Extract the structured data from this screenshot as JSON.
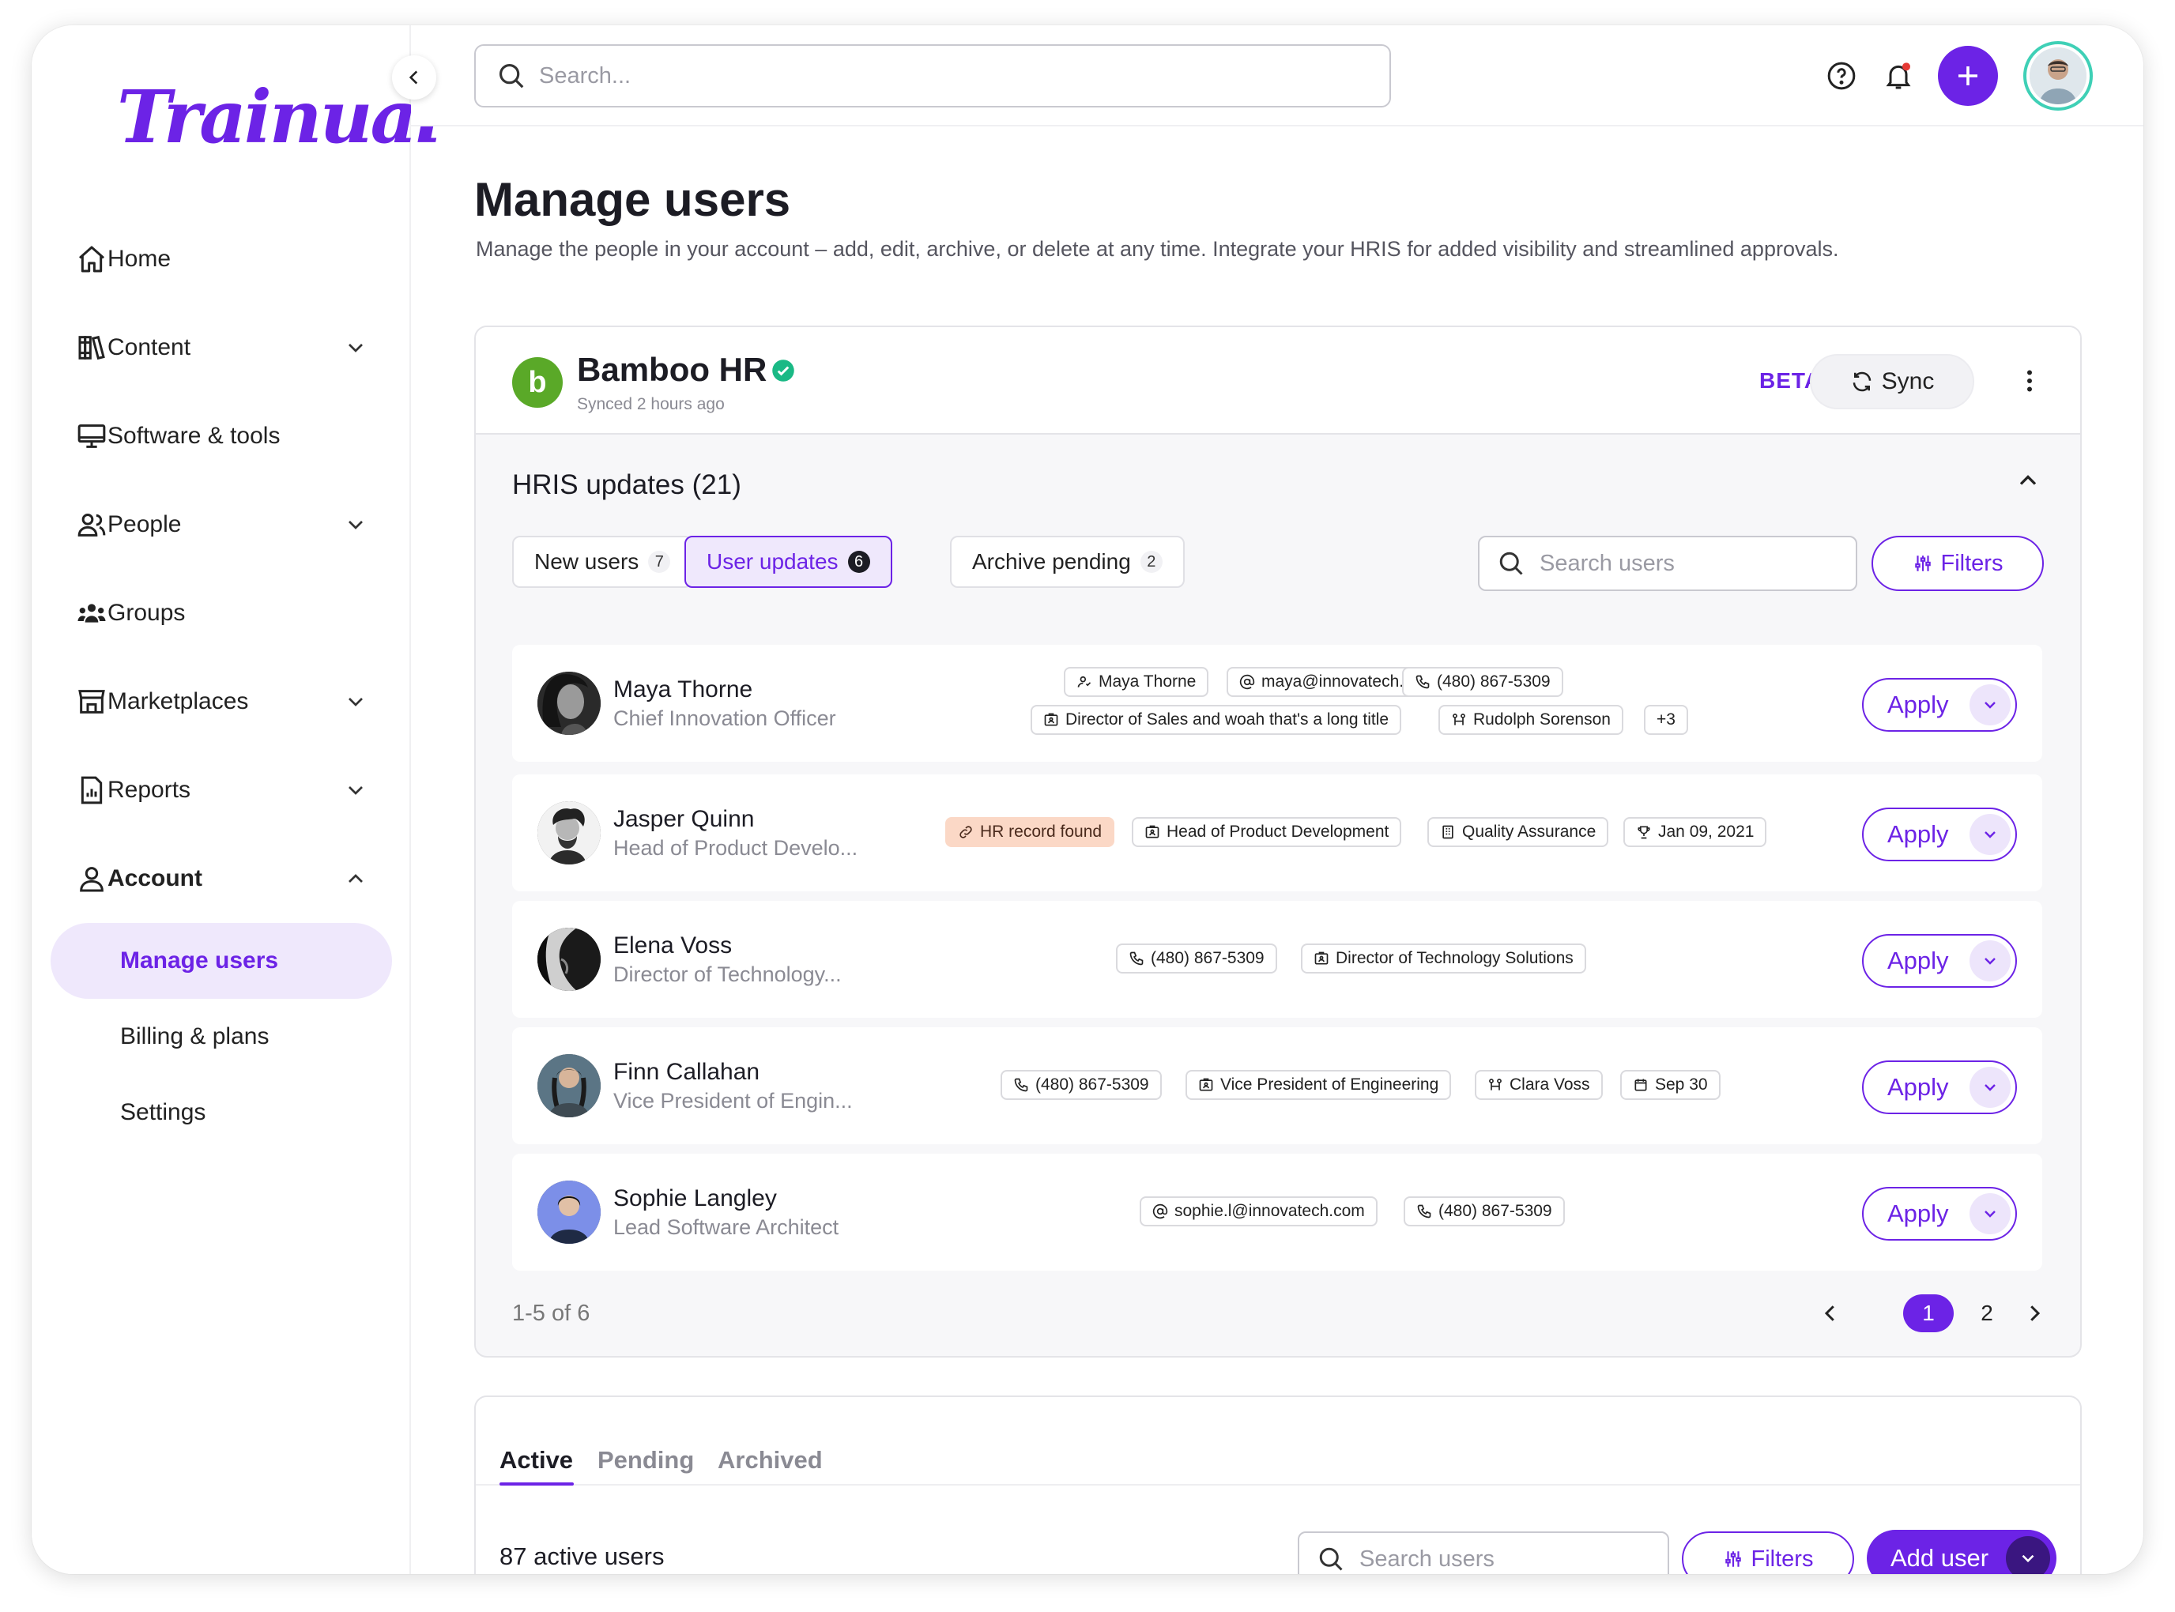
{
  "app": {
    "logo": "Trainual",
    "brand_color": "#6c23e6"
  },
  "sidebar": {
    "items": [
      {
        "label": "Home",
        "icon": "home-icon",
        "expandable": false
      },
      {
        "label": "Content",
        "icon": "books-icon",
        "expandable": true
      },
      {
        "label": "Software & tools",
        "icon": "monitor-icon",
        "expandable": false
      },
      {
        "label": "People",
        "icon": "people-icon",
        "expandable": true
      },
      {
        "label": "Groups",
        "icon": "groups-icon",
        "expandable": false
      },
      {
        "label": "Marketplaces",
        "icon": "store-icon",
        "expandable": true
      },
      {
        "label": "Reports",
        "icon": "report-icon",
        "expandable": true
      },
      {
        "label": "Account",
        "icon": "user-icon",
        "expandable": true,
        "expanded": true
      }
    ],
    "account_sub": [
      {
        "label": "Manage users",
        "active": true
      },
      {
        "label": "Billing & plans",
        "active": false
      },
      {
        "label": "Settings",
        "active": false
      }
    ]
  },
  "topbar": {
    "search_placeholder": "Search..."
  },
  "page": {
    "title": "Manage users",
    "description": "Manage the people in your account – add, edit, archive, or delete at any time. Integrate your HRIS for added visibility and streamlined approvals."
  },
  "hris": {
    "name": "Bamboo HR",
    "synced": "Synced 2 hours ago",
    "beta": "BETA",
    "sync_label": "Sync",
    "updates_title": "HRIS updates (21)",
    "tabs": [
      {
        "label": "New users",
        "count": "7"
      },
      {
        "label": "User updates",
        "count": "6"
      },
      {
        "label": "Archive pending",
        "count": "2"
      }
    ],
    "search_placeholder": "Search users",
    "filters_label": "Filters",
    "apply_label": "Apply",
    "rows": [
      {
        "name": "Maya Thorne",
        "title": "Chief Innovation Officer",
        "chips": [
          {
            "icon": "user-icon",
            "text": "Maya Thorne"
          },
          {
            "icon": "at-icon",
            "text": "maya@innovatech.com"
          },
          {
            "icon": "phone-icon",
            "text": "(480) 867-5309"
          },
          {
            "icon": "badge-icon",
            "text": "Director of Sales and woah that's a long title"
          },
          {
            "icon": "org-icon",
            "text": "Rudolph Sorenson"
          },
          {
            "icon": "",
            "text": "+3"
          }
        ]
      },
      {
        "name": "Jasper Quinn",
        "title": "Head of Product Develo...",
        "chips": [
          {
            "icon": "link-icon",
            "text": "HR record found",
            "highlight": true
          },
          {
            "icon": "badge-icon",
            "text": "Head of Product Development"
          },
          {
            "icon": "building-icon",
            "text": "Quality Assurance"
          },
          {
            "icon": "trophy-icon",
            "text": "Jan 09, 2021"
          }
        ]
      },
      {
        "name": "Elena Voss",
        "title": "Director of Technology...",
        "chips": [
          {
            "icon": "phone-icon",
            "text": "(480) 867-5309"
          },
          {
            "icon": "badge-icon",
            "text": "Director of Technology Solutions"
          }
        ]
      },
      {
        "name": "Finn Callahan",
        "title": "Vice President of Engin...",
        "chips": [
          {
            "icon": "phone-icon",
            "text": "(480) 867-5309"
          },
          {
            "icon": "badge-icon",
            "text": "Vice President of Engineering"
          },
          {
            "icon": "org-icon",
            "text": "Clara Voss"
          },
          {
            "icon": "calendar-icon",
            "text": "Sep 30"
          }
        ]
      },
      {
        "name": "Sophie Langley",
        "title": "Lead Software Architect",
        "chips": [
          {
            "icon": "at-icon",
            "text": "sophie.l@innovatech.com"
          },
          {
            "icon": "phone-icon",
            "text": "(480) 867-5309"
          }
        ]
      }
    ],
    "pagination": {
      "summary": "1-5 of 6",
      "pages": [
        "1",
        "2"
      ],
      "current": "1"
    }
  },
  "users": {
    "tabs": [
      {
        "label": "Active",
        "active": true
      },
      {
        "label": "Pending",
        "active": false
      },
      {
        "label": "Archived",
        "active": false
      }
    ],
    "count_label": "87 active users",
    "search_placeholder": "Search users",
    "filters_label": "Filters",
    "add_user_label": "Add user"
  }
}
